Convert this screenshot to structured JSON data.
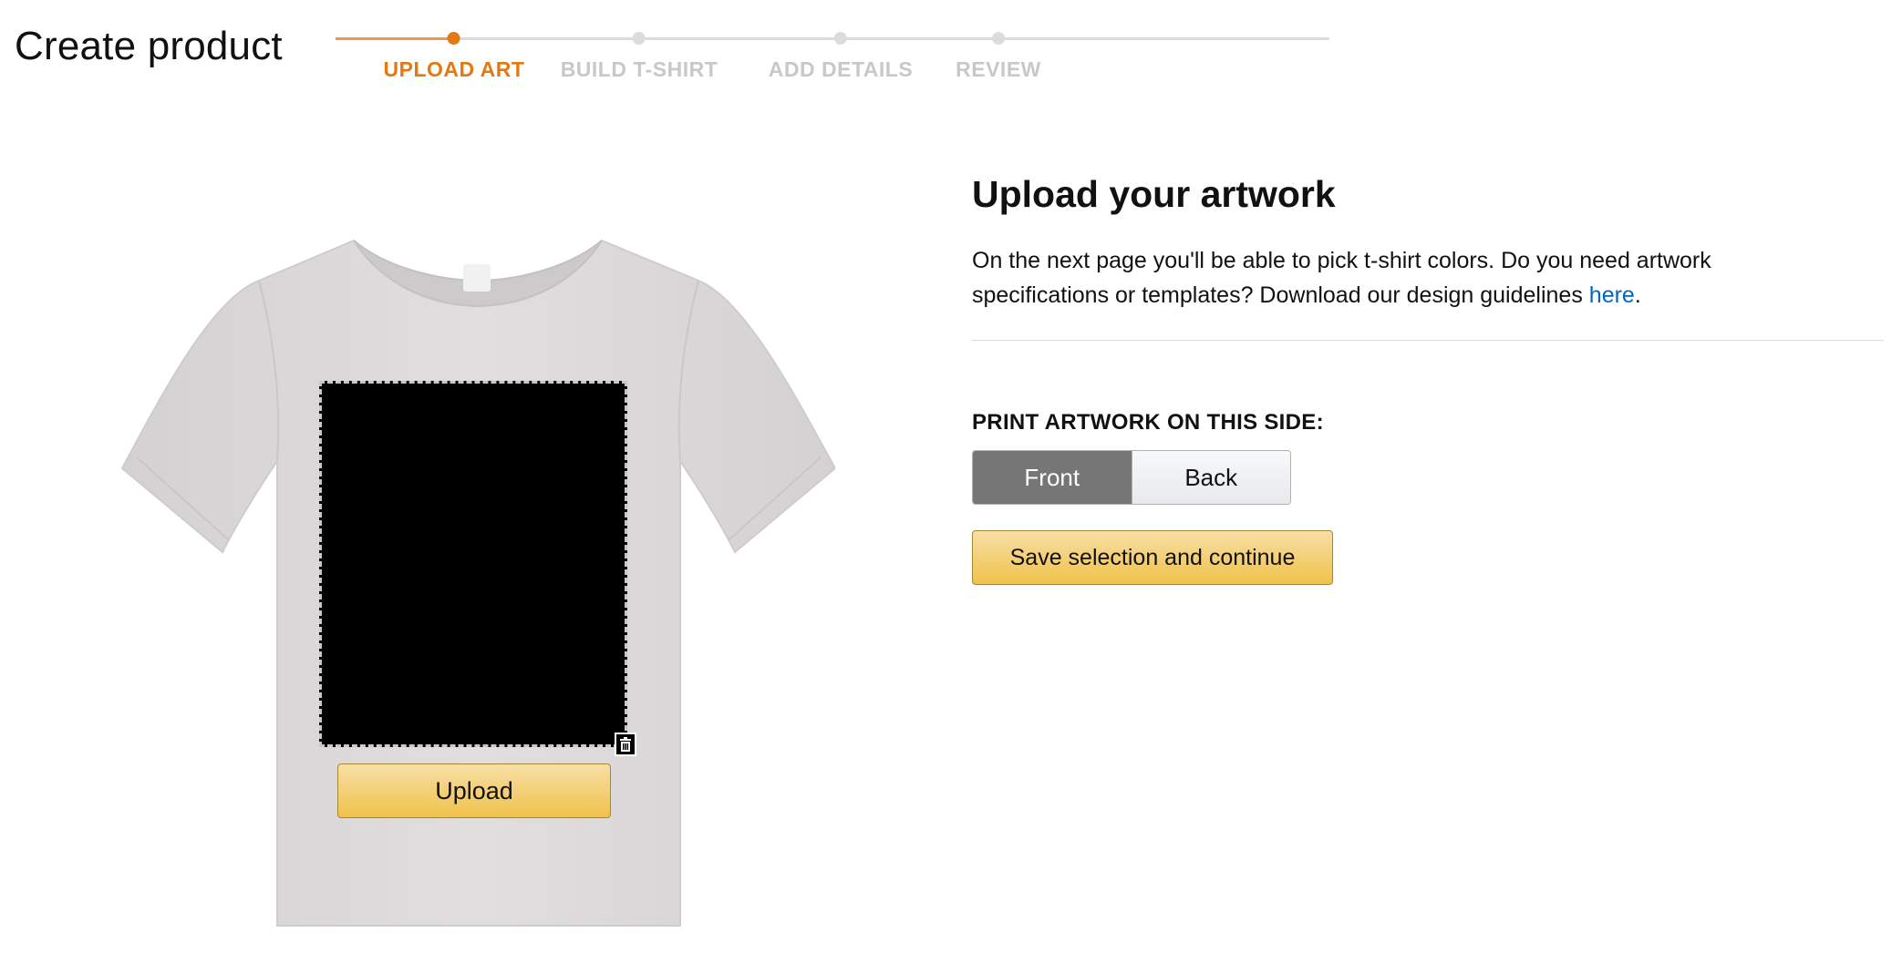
{
  "header": {
    "title": "Create product"
  },
  "stepper": {
    "steps": [
      {
        "label": "UPLOAD ART",
        "state": "active"
      },
      {
        "label": "BUILD T-SHIRT",
        "state": "pending"
      },
      {
        "label": "ADD DETAILS",
        "state": "pending"
      },
      {
        "label": "REVIEW",
        "state": "pending"
      }
    ],
    "active_color": "#e47911",
    "pending_color": "#c8c8c8"
  },
  "preview": {
    "shirt_color": "#dcd9da",
    "upload_label": "Upload",
    "trash_icon": "trash-icon"
  },
  "panel": {
    "title": "Upload your artwork",
    "desc_part1": "On the next page you'll be able to pick t-shirt colors. Do you need artwork specifications or templates? Download our design guidelines ",
    "link_text": "here",
    "desc_part2": ".",
    "side_heading": "PRINT ARTWORK ON THIS SIDE:",
    "sides": [
      {
        "label": "Front",
        "selected": true
      },
      {
        "label": "Back",
        "selected": false
      }
    ],
    "save_label": "Save selection and continue",
    "button_color": "#f0c14b",
    "link_color": "#0066c0"
  }
}
